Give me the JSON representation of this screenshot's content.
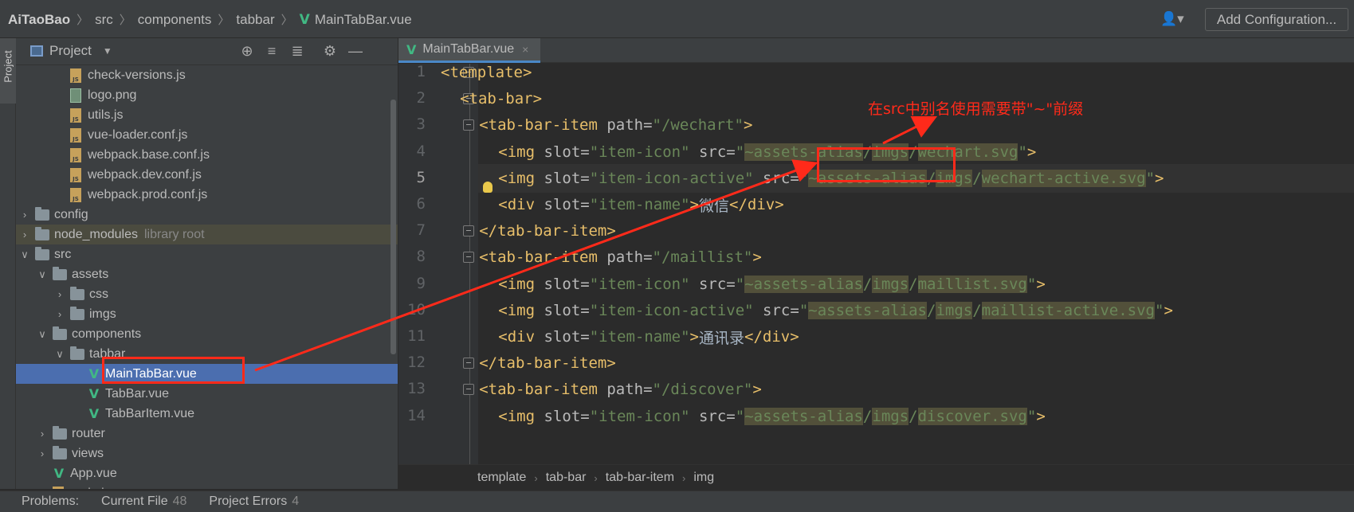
{
  "navbar": {
    "breadcrumbs": [
      "AiTaoBao",
      "src",
      "components",
      "tabbar",
      "MainTabBar.vue"
    ],
    "user_icon": "user-icon",
    "add_configuration": "Add Configuration..."
  },
  "left_strip": {
    "label": "Project"
  },
  "project_panel": {
    "title": "Project",
    "tools": [
      "locate-icon",
      "expand-all-icon",
      "collapse-all-icon",
      "gear-icon",
      "minimize-icon"
    ],
    "tree": [
      {
        "label": "check-versions.js",
        "kind": "js",
        "depth": 3
      },
      {
        "label": "logo.png",
        "kind": "png",
        "depth": 3
      },
      {
        "label": "utils.js",
        "kind": "js",
        "depth": 3
      },
      {
        "label": "vue-loader.conf.js",
        "kind": "js",
        "depth": 3
      },
      {
        "label": "webpack.base.conf.js",
        "kind": "js",
        "depth": 3
      },
      {
        "label": "webpack.dev.conf.js",
        "kind": "js",
        "depth": 3
      },
      {
        "label": "webpack.prod.conf.js",
        "kind": "js",
        "depth": 3
      },
      {
        "label": "config",
        "kind": "folder",
        "depth": 1,
        "arrow": "collapsed"
      },
      {
        "label": "node_modules",
        "kind": "folder",
        "depth": 1,
        "arrow": "collapsed",
        "tag": "library root"
      },
      {
        "label": "src",
        "kind": "folder",
        "depth": 1,
        "arrow": "expanded"
      },
      {
        "label": "assets",
        "kind": "folder",
        "depth": 2,
        "arrow": "expanded"
      },
      {
        "label": "css",
        "kind": "folder",
        "depth": 3,
        "arrow": "collapsed"
      },
      {
        "label": "imgs",
        "kind": "folder",
        "depth": 3,
        "arrow": "collapsed"
      },
      {
        "label": "components",
        "kind": "folder",
        "depth": 2,
        "arrow": "expanded"
      },
      {
        "label": "tabbar",
        "kind": "folder",
        "depth": 3,
        "arrow": "expanded"
      },
      {
        "label": "MainTabBar.vue",
        "kind": "vue",
        "depth": 4,
        "selected": true
      },
      {
        "label": "TabBar.vue",
        "kind": "vue",
        "depth": 4
      },
      {
        "label": "TabBarItem.vue",
        "kind": "vue",
        "depth": 4
      },
      {
        "label": "router",
        "kind": "folder",
        "depth": 2,
        "arrow": "collapsed"
      },
      {
        "label": "views",
        "kind": "folder",
        "depth": 2,
        "arrow": "collapsed"
      },
      {
        "label": "App.vue",
        "kind": "vue",
        "depth": 2
      },
      {
        "label": "main.js",
        "kind": "js",
        "depth": 2
      }
    ]
  },
  "editor": {
    "tab": {
      "label": "MainTabBar.vue",
      "close": "×"
    },
    "current_line": 5,
    "lines": [
      {
        "n": "1",
        "fold": true,
        "indent": 0,
        "tokens": [
          [
            "tg",
            "<template>"
          ]
        ]
      },
      {
        "n": "2",
        "fold": true,
        "indent": 1,
        "tokens": [
          [
            "tg",
            "<tab-bar>"
          ]
        ]
      },
      {
        "n": "3",
        "fold": true,
        "indent": 2,
        "tokens": [
          [
            "tg",
            "<tab-bar-item "
          ],
          [
            "at",
            "path="
          ],
          [
            "sv",
            "\"/wechart\""
          ],
          [
            "tg",
            ">"
          ]
        ]
      },
      {
        "n": "4",
        "fold": false,
        "indent": 3,
        "tokens": [
          [
            "tg",
            "<img "
          ],
          [
            "at",
            "slot="
          ],
          [
            "sv",
            "\"item-icon\" "
          ],
          [
            "at",
            "src="
          ],
          [
            "sv",
            "\""
          ],
          [
            "svh",
            "~assets-alias"
          ],
          [
            "sv",
            "/"
          ],
          [
            "svh",
            "imgs"
          ],
          [
            "sv",
            "/"
          ],
          [
            "svh",
            "wechart.svg"
          ],
          [
            "sv",
            "\""
          ],
          [
            "tg",
            ">"
          ]
        ]
      },
      {
        "n": "5",
        "fold": false,
        "indent": 3,
        "tokens": [
          [
            "tg",
            "<img "
          ],
          [
            "at",
            "slot="
          ],
          [
            "sv",
            "\"item-icon-active\" "
          ],
          [
            "at",
            "src="
          ],
          [
            "sv",
            "\""
          ],
          [
            "svh",
            "~assets-alias"
          ],
          [
            "sv",
            "/"
          ],
          [
            "svh",
            "imgs"
          ],
          [
            "sv",
            "/"
          ],
          [
            "svh",
            "wechart-active.svg"
          ],
          [
            "sv",
            "\""
          ],
          [
            "tg",
            ">"
          ]
        ]
      },
      {
        "n": "6",
        "fold": false,
        "indent": 3,
        "tokens": [
          [
            "tg",
            "<div "
          ],
          [
            "at",
            "slot="
          ],
          [
            "sv",
            "\"item-name\""
          ],
          [
            "tg",
            ">"
          ],
          [
            "tx",
            "微信"
          ],
          [
            "tg",
            "</div>"
          ]
        ]
      },
      {
        "n": "7",
        "fold": true,
        "indent": 2,
        "tokens": [
          [
            "tg",
            "</tab-bar-item>"
          ]
        ]
      },
      {
        "n": "8",
        "fold": true,
        "indent": 2,
        "tokens": [
          [
            "tg",
            "<tab-bar-item "
          ],
          [
            "at",
            "path="
          ],
          [
            "sv",
            "\"/maillist\""
          ],
          [
            "tg",
            ">"
          ]
        ]
      },
      {
        "n": "9",
        "fold": false,
        "indent": 3,
        "tokens": [
          [
            "tg",
            "<img "
          ],
          [
            "at",
            "slot="
          ],
          [
            "sv",
            "\"item-icon\" "
          ],
          [
            "at",
            "src="
          ],
          [
            "sv",
            "\""
          ],
          [
            "svh",
            "~assets-alias"
          ],
          [
            "sv",
            "/"
          ],
          [
            "svh",
            "imgs"
          ],
          [
            "sv",
            "/"
          ],
          [
            "svh",
            "maillist.svg"
          ],
          [
            "sv",
            "\""
          ],
          [
            "tg",
            ">"
          ]
        ]
      },
      {
        "n": "10",
        "fold": false,
        "indent": 3,
        "tokens": [
          [
            "tg",
            "<img "
          ],
          [
            "at",
            "slot="
          ],
          [
            "sv",
            "\"item-icon-active\" "
          ],
          [
            "at",
            "src="
          ],
          [
            "sv",
            "\""
          ],
          [
            "svh",
            "~assets-alias"
          ],
          [
            "sv",
            "/"
          ],
          [
            "svh",
            "imgs"
          ],
          [
            "sv",
            "/"
          ],
          [
            "svh",
            "maillist-active.svg"
          ],
          [
            "sv",
            "\""
          ],
          [
            "tg",
            ">"
          ]
        ]
      },
      {
        "n": "11",
        "fold": false,
        "indent": 3,
        "tokens": [
          [
            "tg",
            "<div "
          ],
          [
            "at",
            "slot="
          ],
          [
            "sv",
            "\"item-name\""
          ],
          [
            "tg",
            ">"
          ],
          [
            "tx",
            "通讯录"
          ],
          [
            "tg",
            "</div>"
          ]
        ]
      },
      {
        "n": "12",
        "fold": true,
        "indent": 2,
        "tokens": [
          [
            "tg",
            "</tab-bar-item>"
          ]
        ]
      },
      {
        "n": "13",
        "fold": true,
        "indent": 2,
        "tokens": [
          [
            "tg",
            "<tab-bar-item "
          ],
          [
            "at",
            "path="
          ],
          [
            "sv",
            "\"/discover\""
          ],
          [
            "tg",
            ">"
          ]
        ]
      },
      {
        "n": "14",
        "fold": false,
        "indent": 3,
        "tokens": [
          [
            "tg",
            "<img "
          ],
          [
            "at",
            "slot="
          ],
          [
            "sv",
            "\"item-icon\" "
          ],
          [
            "at",
            "src="
          ],
          [
            "sv",
            "\""
          ],
          [
            "svh",
            "~assets-alias"
          ],
          [
            "sv",
            "/"
          ],
          [
            "svh",
            "imgs"
          ],
          [
            "sv",
            "/"
          ],
          [
            "svh",
            "discover.svg"
          ],
          [
            "sv",
            "\""
          ],
          [
            "tg",
            ">"
          ]
        ]
      }
    ],
    "breadcrumbs": [
      "template",
      "tab-bar",
      "tab-bar-item",
      "img"
    ]
  },
  "annotation": {
    "note": "在src中别名使用需要带\"~\"前缀",
    "color": "#ff2a1a"
  },
  "status_bar": {
    "problems_label": "Problems:",
    "current_file_label": "Current File",
    "current_file_count": "48",
    "project_errors_label": "Project Errors",
    "project_errors_count": "4"
  },
  "colors": {
    "tag": "#e8bf6a",
    "attribute": "#bababa",
    "string": "#6a8759",
    "selection": "#4b6eaf",
    "vue": "#41b883"
  }
}
